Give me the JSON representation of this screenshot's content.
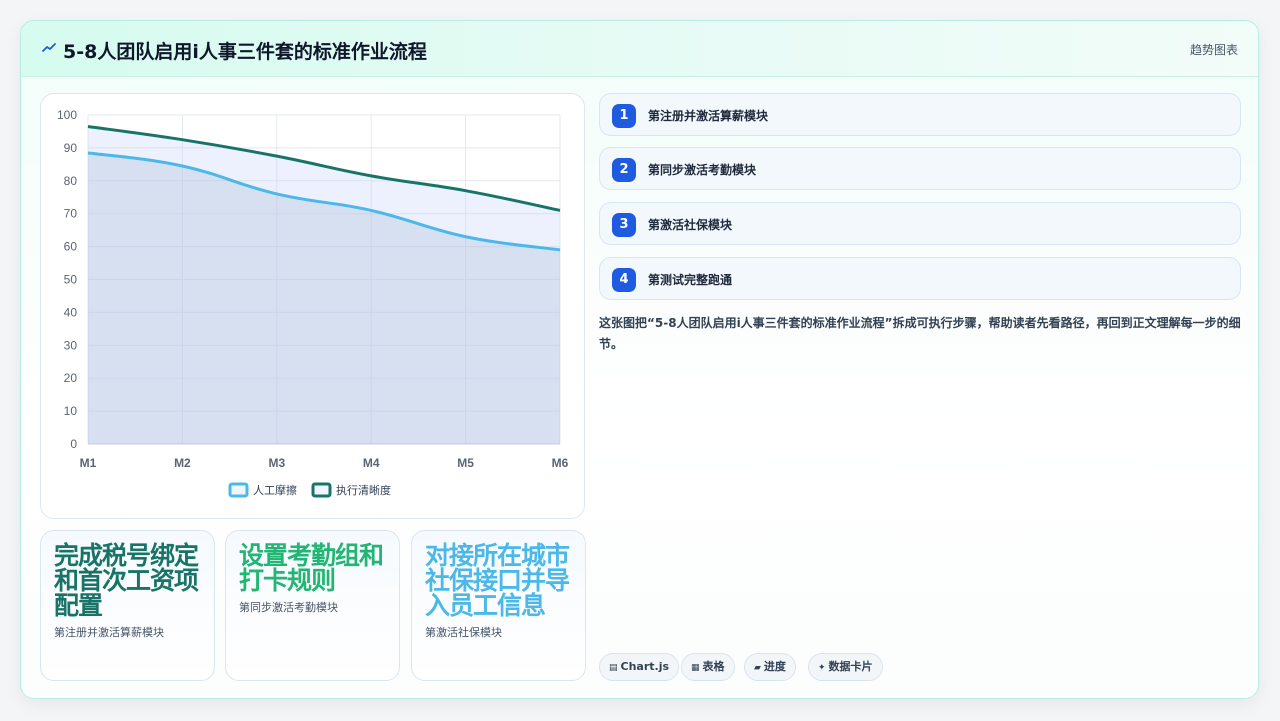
{
  "header": {
    "title": "5-8人团队启用i人事三件套的标准作业流程",
    "tag": "趋势图表"
  },
  "colors": {
    "series1": "#4cb8e8",
    "series2": "#177467",
    "accent": "#1f5be0",
    "stat1": "#177467",
    "stat2": "#22b573",
    "stat3": "#4cb8e8"
  },
  "chart_data": {
    "type": "line",
    "x": [
      "M1",
      "M2",
      "M3",
      "M4",
      "M5",
      "M6"
    ],
    "ylim": [
      0,
      100
    ],
    "yticks": [
      0,
      10,
      20,
      30,
      40,
      50,
      60,
      70,
      80,
      90,
      100
    ],
    "grid": true,
    "legend_position": "bottom",
    "series": [
      {
        "name": "人工摩擦",
        "values": [
          88.5,
          84.5,
          76,
          71,
          63,
          59
        ],
        "fill": true
      },
      {
        "name": "执行清晰度",
        "values": [
          96.5,
          92.5,
          87.5,
          81.5,
          77,
          71
        ],
        "fill": true
      }
    ]
  },
  "stats": [
    {
      "value": "完成税号绑定和首次工资项配置",
      "label": "第注册并激活算薪模块"
    },
    {
      "value": "设置考勤组和打卡规则",
      "label": "第同步激活考勤模块"
    },
    {
      "value": "对接所在城市社保接口并导入员工信息",
      "label": "第激活社保模块"
    }
  ],
  "steps": [
    {
      "num": "1",
      "label": "第注册并激活算薪模块"
    },
    {
      "num": "2",
      "label": "第同步激活考勤模块"
    },
    {
      "num": "3",
      "label": "第激活社保模块"
    },
    {
      "num": "4",
      "label": "第测试完整跑通"
    }
  ],
  "description": "这张图把“5-8人团队启用i人事三件套的标准作业流程”拆成可执行步骤，帮助读者先看路径，再回到正文理解每一步的细节。",
  "chips": [
    {
      "icon": "▤",
      "label": "Chart.js"
    },
    {
      "icon": "▦",
      "label": "表格"
    },
    {
      "icon": "▰",
      "label": "进度"
    },
    {
      "icon": "✦",
      "label": "数据卡片"
    }
  ]
}
